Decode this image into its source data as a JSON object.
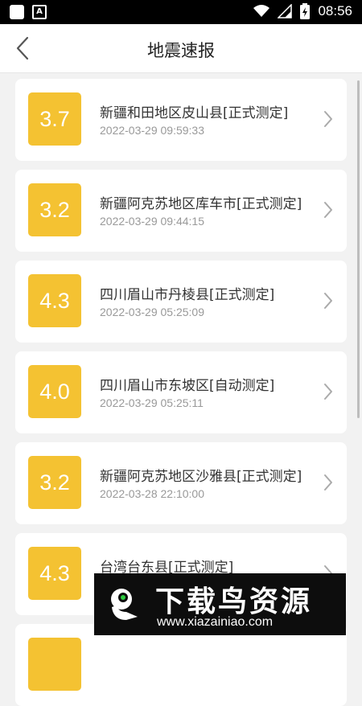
{
  "status_bar": {
    "time": "08:56",
    "notif_letter": "A"
  },
  "header": {
    "title": "地震速报"
  },
  "quakes": [
    {
      "magnitude": "3.7",
      "place": "新疆和田地区皮山县[正式测定]",
      "time": "2022-03-29 09:59:33"
    },
    {
      "magnitude": "3.2",
      "place": "新疆阿克苏地区库车市[正式测定]",
      "time": "2022-03-29 09:44:15"
    },
    {
      "magnitude": "4.3",
      "place": "四川眉山市丹棱县[正式测定]",
      "time": "2022-03-29 05:25:09"
    },
    {
      "magnitude": "4.0",
      "place": "四川眉山市东坡区[自动测定]",
      "time": "2022-03-29 05:25:11"
    },
    {
      "magnitude": "3.2",
      "place": "新疆阿克苏地区沙雅县[正式测定]",
      "time": "2022-03-28 22:10:00"
    },
    {
      "magnitude": "4.3",
      "place": "台湾台东县[正式测定]",
      "time": ""
    }
  ],
  "watermark": {
    "title": "下载鸟资源",
    "url": "www.xiazainiao.com"
  },
  "colors": {
    "badge": "#f4c232",
    "background": "#f2f2f2"
  },
  "icons": {
    "back": "chevron-left-icon",
    "item": "chevron-right-icon"
  }
}
